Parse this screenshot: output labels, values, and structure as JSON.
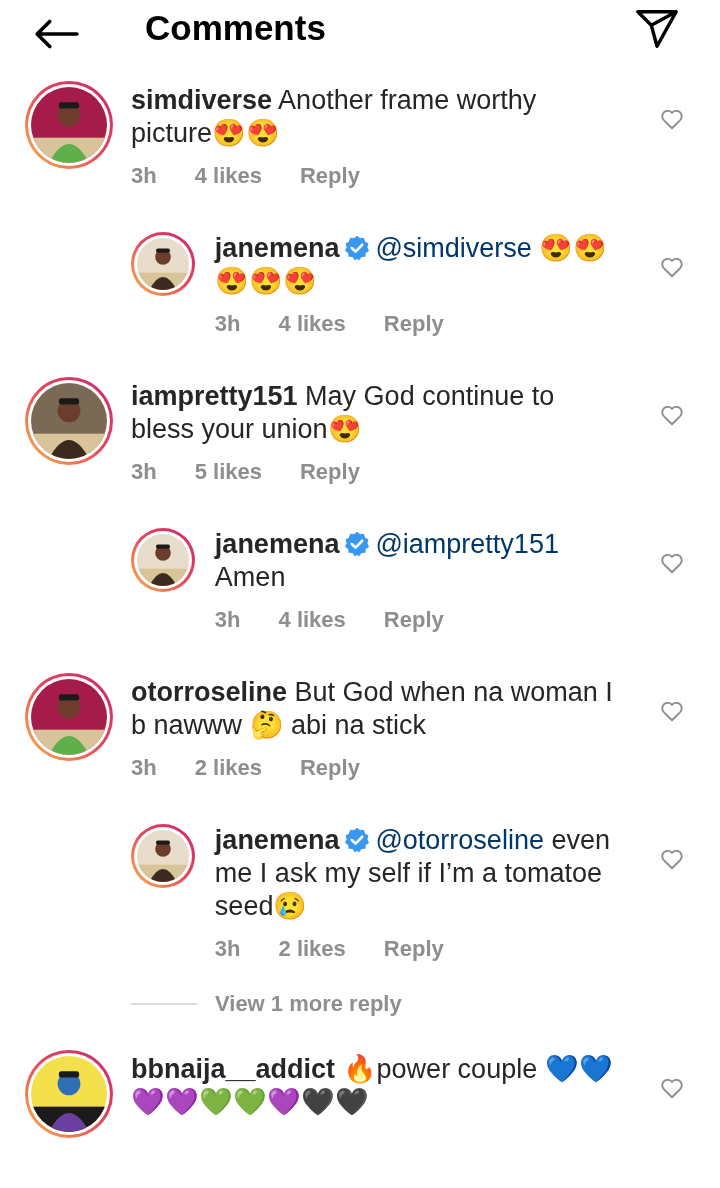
{
  "header": {
    "title": "Comments"
  },
  "comments": [
    {
      "username": "simdiverse",
      "verified": false,
      "text": "Another frame worthy picture😍😍",
      "time": "3h",
      "likes": "4 likes",
      "reply_label": "Reply",
      "liked": false,
      "replies": [
        {
          "username": "janemena",
          "verified": true,
          "mention": "@simdiverse",
          "text": " 😍😍 😍😍😍",
          "time": "3h",
          "likes": "4 likes",
          "reply_label": "Reply",
          "liked": false
        }
      ]
    },
    {
      "username": "iampretty151",
      "verified": false,
      "text": "May God continue to bless your union😍",
      "time": "3h",
      "likes": "5 likes",
      "reply_label": "Reply",
      "liked": false,
      "replies": [
        {
          "username": "janemena",
          "verified": true,
          "mention": "@iampretty151",
          "text": " Amen",
          "time": "3h",
          "likes": "4 likes",
          "reply_label": "Reply",
          "liked": false
        }
      ]
    },
    {
      "username": "otorroseline",
      "verified": false,
      "text": "But God when na woman I b nawww 🤔 abi na stick",
      "time": "3h",
      "likes": "2 likes",
      "reply_label": "Reply",
      "liked": false,
      "replies": [
        {
          "username": "janemena",
          "verified": true,
          "mention": "@otorroseline",
          "text": " even me I ask my self if I’m a tomatoe seed😢",
          "time": "3h",
          "likes": "2 likes",
          "reply_label": "Reply",
          "liked": false
        }
      ],
      "more_replies": "View 1 more reply"
    },
    {
      "username": "bbnaija__addict",
      "verified": false,
      "text": "🔥power couple 💙💙 💜💜💚💚💜🖤🖤",
      "liked": false
    }
  ]
}
